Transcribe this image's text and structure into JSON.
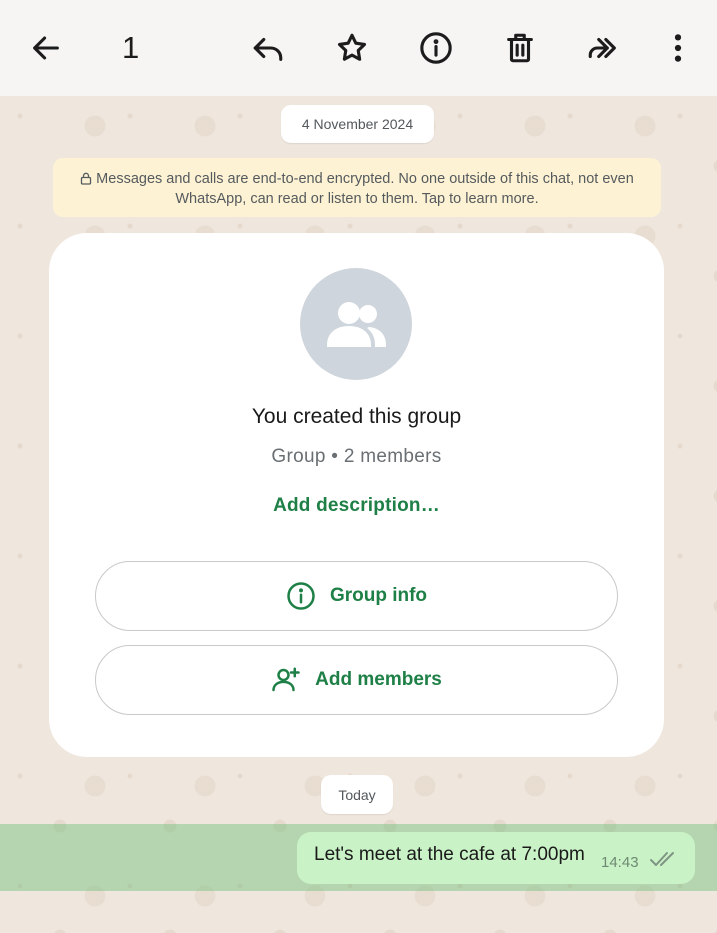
{
  "toolbar": {
    "selected_count": "1",
    "icons": [
      "back-arrow-icon",
      "reply-icon",
      "star-icon",
      "info-icon",
      "delete-icon",
      "forward-icon",
      "more-vertical-icon"
    ]
  },
  "chat": {
    "date_label": "4 November 2024",
    "encryption_notice": "Messages and calls are end-to-end encrypted. No one outside of this chat, not even WhatsApp, can read or listen to them. Tap to learn more.",
    "group_card": {
      "title": "You created this group",
      "subtitle": "Group • 2 members",
      "add_description": "Add description…",
      "group_info_label": "Group info",
      "add_members_label": "Add members"
    },
    "today_label": "Today",
    "message": {
      "text": "Let's meet at the cafe at 7:00pm",
      "time": "14:43",
      "status": "read"
    }
  },
  "colors": {
    "accent_green": "#1e8046",
    "outgoing_bubble": "#c9f2c6",
    "encryption_bg": "#fdf3d4",
    "chat_bg": "#efe7de"
  }
}
